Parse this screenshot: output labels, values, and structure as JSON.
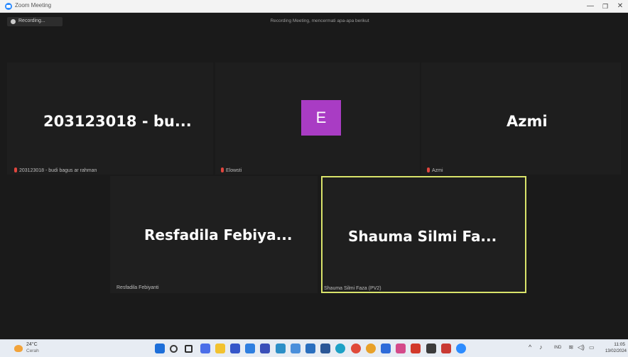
{
  "window": {
    "title": "Zoom Meeting",
    "minimize": "—",
    "maximize": "❐",
    "close": "✕"
  },
  "meeting": {
    "recording_label": "Recording...",
    "notice": "Recording Meeting, mencermati apa-apa berikut"
  },
  "tiles": {
    "t1": {
      "name": "203123018 - bu...",
      "tag": "203123018 - budi bagus ar rahman"
    },
    "t2": {
      "avatar_letter": "E",
      "tag": "Elowsti"
    },
    "t3": {
      "name": "Azmi",
      "tag": "Azmi"
    },
    "t4": {
      "name": "Resfadila Febiya...",
      "tag": "Resfadila Febiyanti"
    },
    "t5": {
      "name": "Shauma Silmi Fa...",
      "tag": "Shauma Silmi Faza (PV2)"
    }
  },
  "taskbar": {
    "weather_temp": "24°C",
    "weather_desc": "Cerah",
    "icons": [
      {
        "name": "windows-start-icon",
        "color": "#1e6fd9"
      },
      {
        "name": "search-icon",
        "color": "#3a3a3a"
      },
      {
        "name": "task-view-icon",
        "color": "#2b2b2b"
      },
      {
        "name": "chat-icon",
        "color": "#4b6ee8"
      },
      {
        "name": "file-explorer-icon",
        "color": "#f2c230"
      },
      {
        "name": "store-icon",
        "color": "#3556c9"
      },
      {
        "name": "app-blue-icon",
        "color": "#2f7fe0"
      },
      {
        "name": "app-indigo-icon",
        "color": "#3a4fb8"
      },
      {
        "name": "app-teal-icon",
        "color": "#2d8fc7"
      },
      {
        "name": "app-notify-icon",
        "color": "#4a8fdb"
      },
      {
        "name": "app-mail-icon",
        "color": "#2a6fbf"
      },
      {
        "name": "app-word-icon",
        "color": "#2b5797"
      },
      {
        "name": "edge-icon",
        "color": "#1da1c6"
      },
      {
        "name": "chrome-icon",
        "color": "#e04a3a"
      },
      {
        "name": "chrome-alt-icon",
        "color": "#e8a12a"
      },
      {
        "name": "notes-icon",
        "color": "#2e6bd9"
      },
      {
        "name": "app-badge-icon",
        "color": "#d44a8a"
      },
      {
        "name": "app-red-icon",
        "color": "#d2392b"
      },
      {
        "name": "app-slash-icon",
        "color": "#3b3b3b"
      },
      {
        "name": "app-pdf-icon",
        "color": "#c93a33"
      },
      {
        "name": "zoom-icon",
        "color": "#2d8cff"
      }
    ],
    "tray_chevron": "^",
    "tray_extra": "♪",
    "tray_lang": "IND",
    "tray_wifi": "≋",
    "tray_volume": "◁)",
    "tray_battery": "▭",
    "time": "11:05",
    "date": "13/02/2024"
  }
}
